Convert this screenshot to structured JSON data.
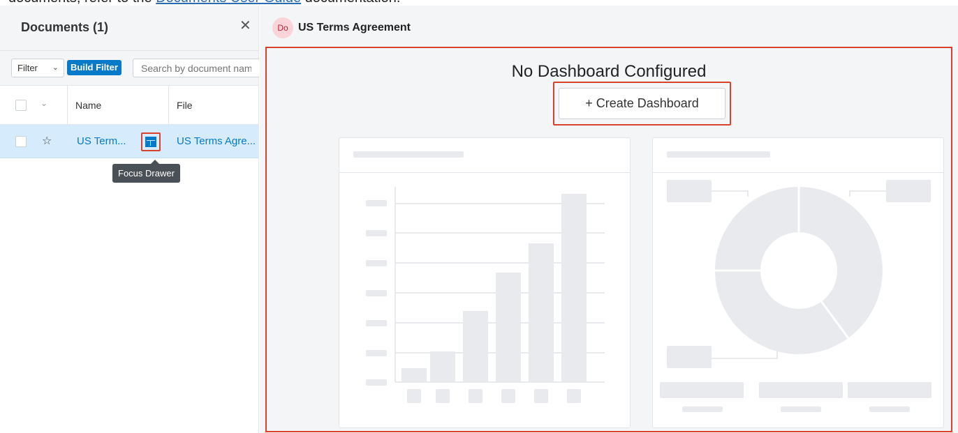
{
  "top_strip": {
    "text_before": "documents, refer to the ",
    "link_text": "Documents User Guide",
    "text_after": " documentation."
  },
  "left_panel": {
    "title": "Documents (1)",
    "close_icon": "close-icon",
    "filter_label": "Filter",
    "build_filter_label": "Build Filter",
    "search_placeholder": "Search by document name...",
    "columns": [
      "Name",
      "File"
    ],
    "rows": [
      {
        "name": "US Term...",
        "file": "US Terms Agre..."
      }
    ],
    "tooltip": "Focus Drawer"
  },
  "right_panel": {
    "badge": "Do",
    "title": "US Terms Agreement",
    "empty_title": "No Dashboard Configured",
    "create_button": "+ Create Dashboard"
  },
  "colors": {
    "accent": "#0679c8",
    "highlight": "#d9412f",
    "selected_row": "#d6ecfd",
    "placeholder": "#e8eaed"
  }
}
